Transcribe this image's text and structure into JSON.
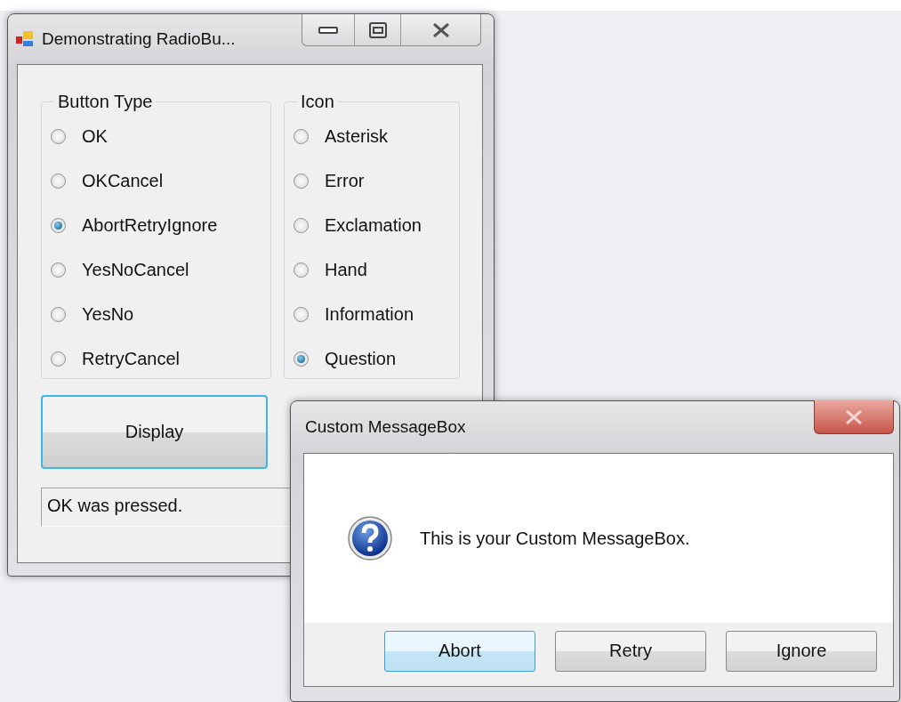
{
  "main_window": {
    "title": "Demonstrating RadioBu...",
    "groups": [
      {
        "label": "Button Type",
        "options": [
          {
            "label": "OK",
            "selected": false
          },
          {
            "label": "OKCancel",
            "selected": false
          },
          {
            "label": "AbortRetryIgnore",
            "selected": true
          },
          {
            "label": "YesNoCancel",
            "selected": false
          },
          {
            "label": "YesNo",
            "selected": false
          },
          {
            "label": "RetryCancel",
            "selected": false
          }
        ]
      },
      {
        "label": "Icon",
        "options": [
          {
            "label": "Asterisk",
            "selected": false
          },
          {
            "label": "Error",
            "selected": false
          },
          {
            "label": "Exclamation",
            "selected": false
          },
          {
            "label": "Hand",
            "selected": false
          },
          {
            "label": "Information",
            "selected": false
          },
          {
            "label": "Question",
            "selected": true
          }
        ]
      }
    ],
    "display_button": {
      "label": "Display",
      "focused": true
    },
    "status": "OK was pressed."
  },
  "message_box": {
    "title": "Custom MessageBox",
    "message": "This is your Custom MessageBox.",
    "buttons": [
      {
        "label": "Abort",
        "default": true
      },
      {
        "label": "Retry",
        "default": false
      },
      {
        "label": "Ignore",
        "default": false
      }
    ]
  }
}
